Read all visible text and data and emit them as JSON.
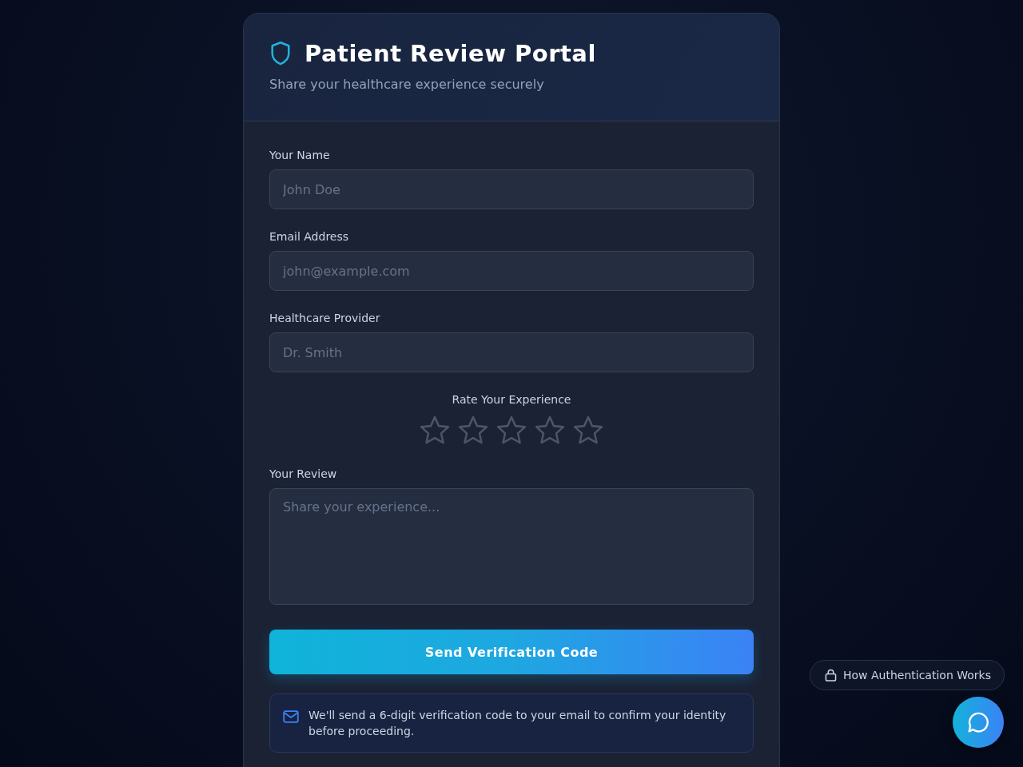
{
  "header": {
    "title": "Patient Review Portal",
    "subtitle": "Share your healthcare experience securely"
  },
  "form": {
    "fields": [
      {
        "kind": "input",
        "label": "Your Name",
        "placeholder": "John Doe"
      },
      {
        "kind": "input",
        "label": "Email Address",
        "placeholder": "john@example.com"
      },
      {
        "kind": "input",
        "label": "Healthcare Provider",
        "placeholder": "Dr. Smith"
      },
      {
        "kind": "rating",
        "label": "Rate Your Experience",
        "stars": 0
      },
      {
        "kind": "textarea",
        "label": "Your Review",
        "placeholder": "Share your experience..."
      }
    ],
    "submit_button": "Send Verification Code",
    "notice": "We'll send a 6-digit verification code to your email to confirm your identity before proceeding."
  },
  "help_button": {
    "label": "How Authentication Works"
  }
}
